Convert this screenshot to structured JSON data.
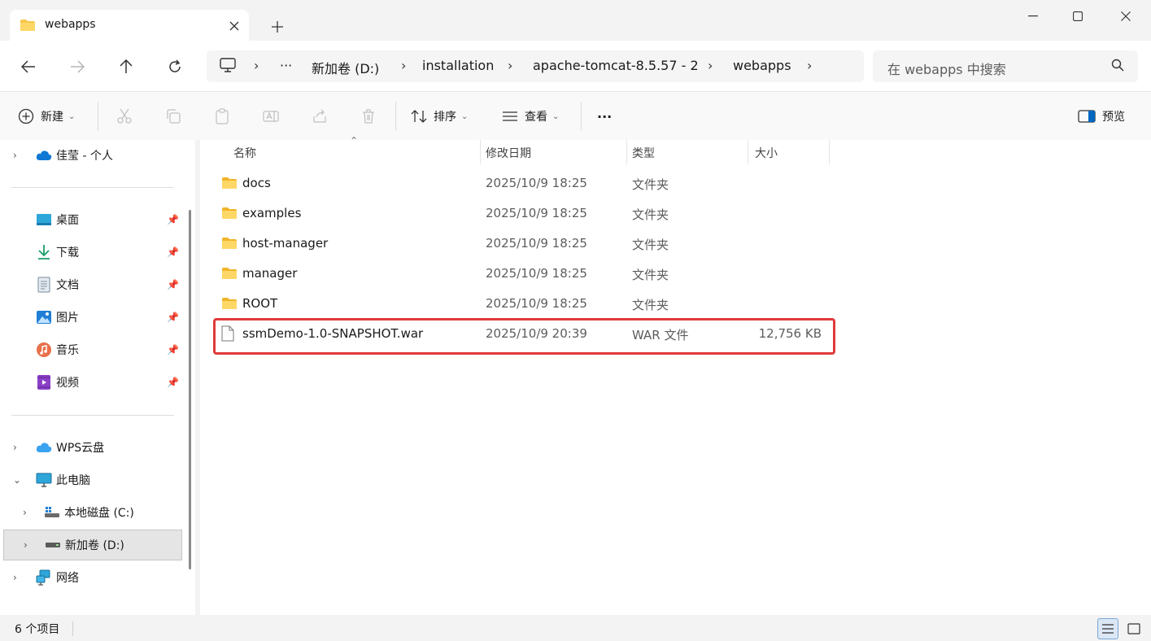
{
  "window": {
    "tab_title": "webapps",
    "tab_close": "×",
    "new_tab": "+"
  },
  "address": {
    "breadcrumbs": [
      "新加卷 (D:)",
      "installation",
      "apache-tomcat-8.5.57 - 2",
      "webapps"
    ],
    "overflow": "···",
    "separator": "›"
  },
  "search": {
    "placeholder": "在 webapps 中搜索"
  },
  "toolbar": {
    "new_label": "新建",
    "sort_label": "排序",
    "view_label": "查看",
    "more_label": "···",
    "preview_label": "预览",
    "chevron": "⌄"
  },
  "sidebar": {
    "onedrive": "佳莹 - 个人",
    "quick": [
      {
        "label": "桌面",
        "icon": "desktop-icon"
      },
      {
        "label": "下载",
        "icon": "download-icon"
      },
      {
        "label": "文档",
        "icon": "document-icon"
      },
      {
        "label": "图片",
        "icon": "pictures-icon"
      },
      {
        "label": "音乐",
        "icon": "music-icon"
      },
      {
        "label": "视频",
        "icon": "video-icon"
      }
    ],
    "wps": "WPS云盘",
    "this_pc": "此电脑",
    "drive_c": "本地磁盘 (C:)",
    "drive_d": "新加卷 (D:)",
    "network": "网络"
  },
  "columns": {
    "name": "名称",
    "date": "修改日期",
    "type": "类型",
    "size": "大小"
  },
  "files": [
    {
      "name": "docs",
      "date": "2025/10/9 18:25",
      "type": "文件夹",
      "size": "",
      "kind": "folder"
    },
    {
      "name": "examples",
      "date": "2025/10/9 18:25",
      "type": "文件夹",
      "size": "",
      "kind": "folder"
    },
    {
      "name": "host-manager",
      "date": "2025/10/9 18:25",
      "type": "文件夹",
      "size": "",
      "kind": "folder"
    },
    {
      "name": "manager",
      "date": "2025/10/9 18:25",
      "type": "文件夹",
      "size": "",
      "kind": "folder"
    },
    {
      "name": "ROOT",
      "date": "2025/10/9 18:25",
      "type": "文件夹",
      "size": "",
      "kind": "folder"
    },
    {
      "name": "ssmDemo-1.0-SNAPSHOT.war",
      "date": "2025/10/9 20:39",
      "type": "WAR 文件",
      "size": "12,756 KB",
      "kind": "file"
    }
  ],
  "status": {
    "count": "6 个项目"
  },
  "colors": {
    "accent": "#0067c0",
    "highlight": "#e03a3a",
    "folder": "#f8c74c"
  }
}
